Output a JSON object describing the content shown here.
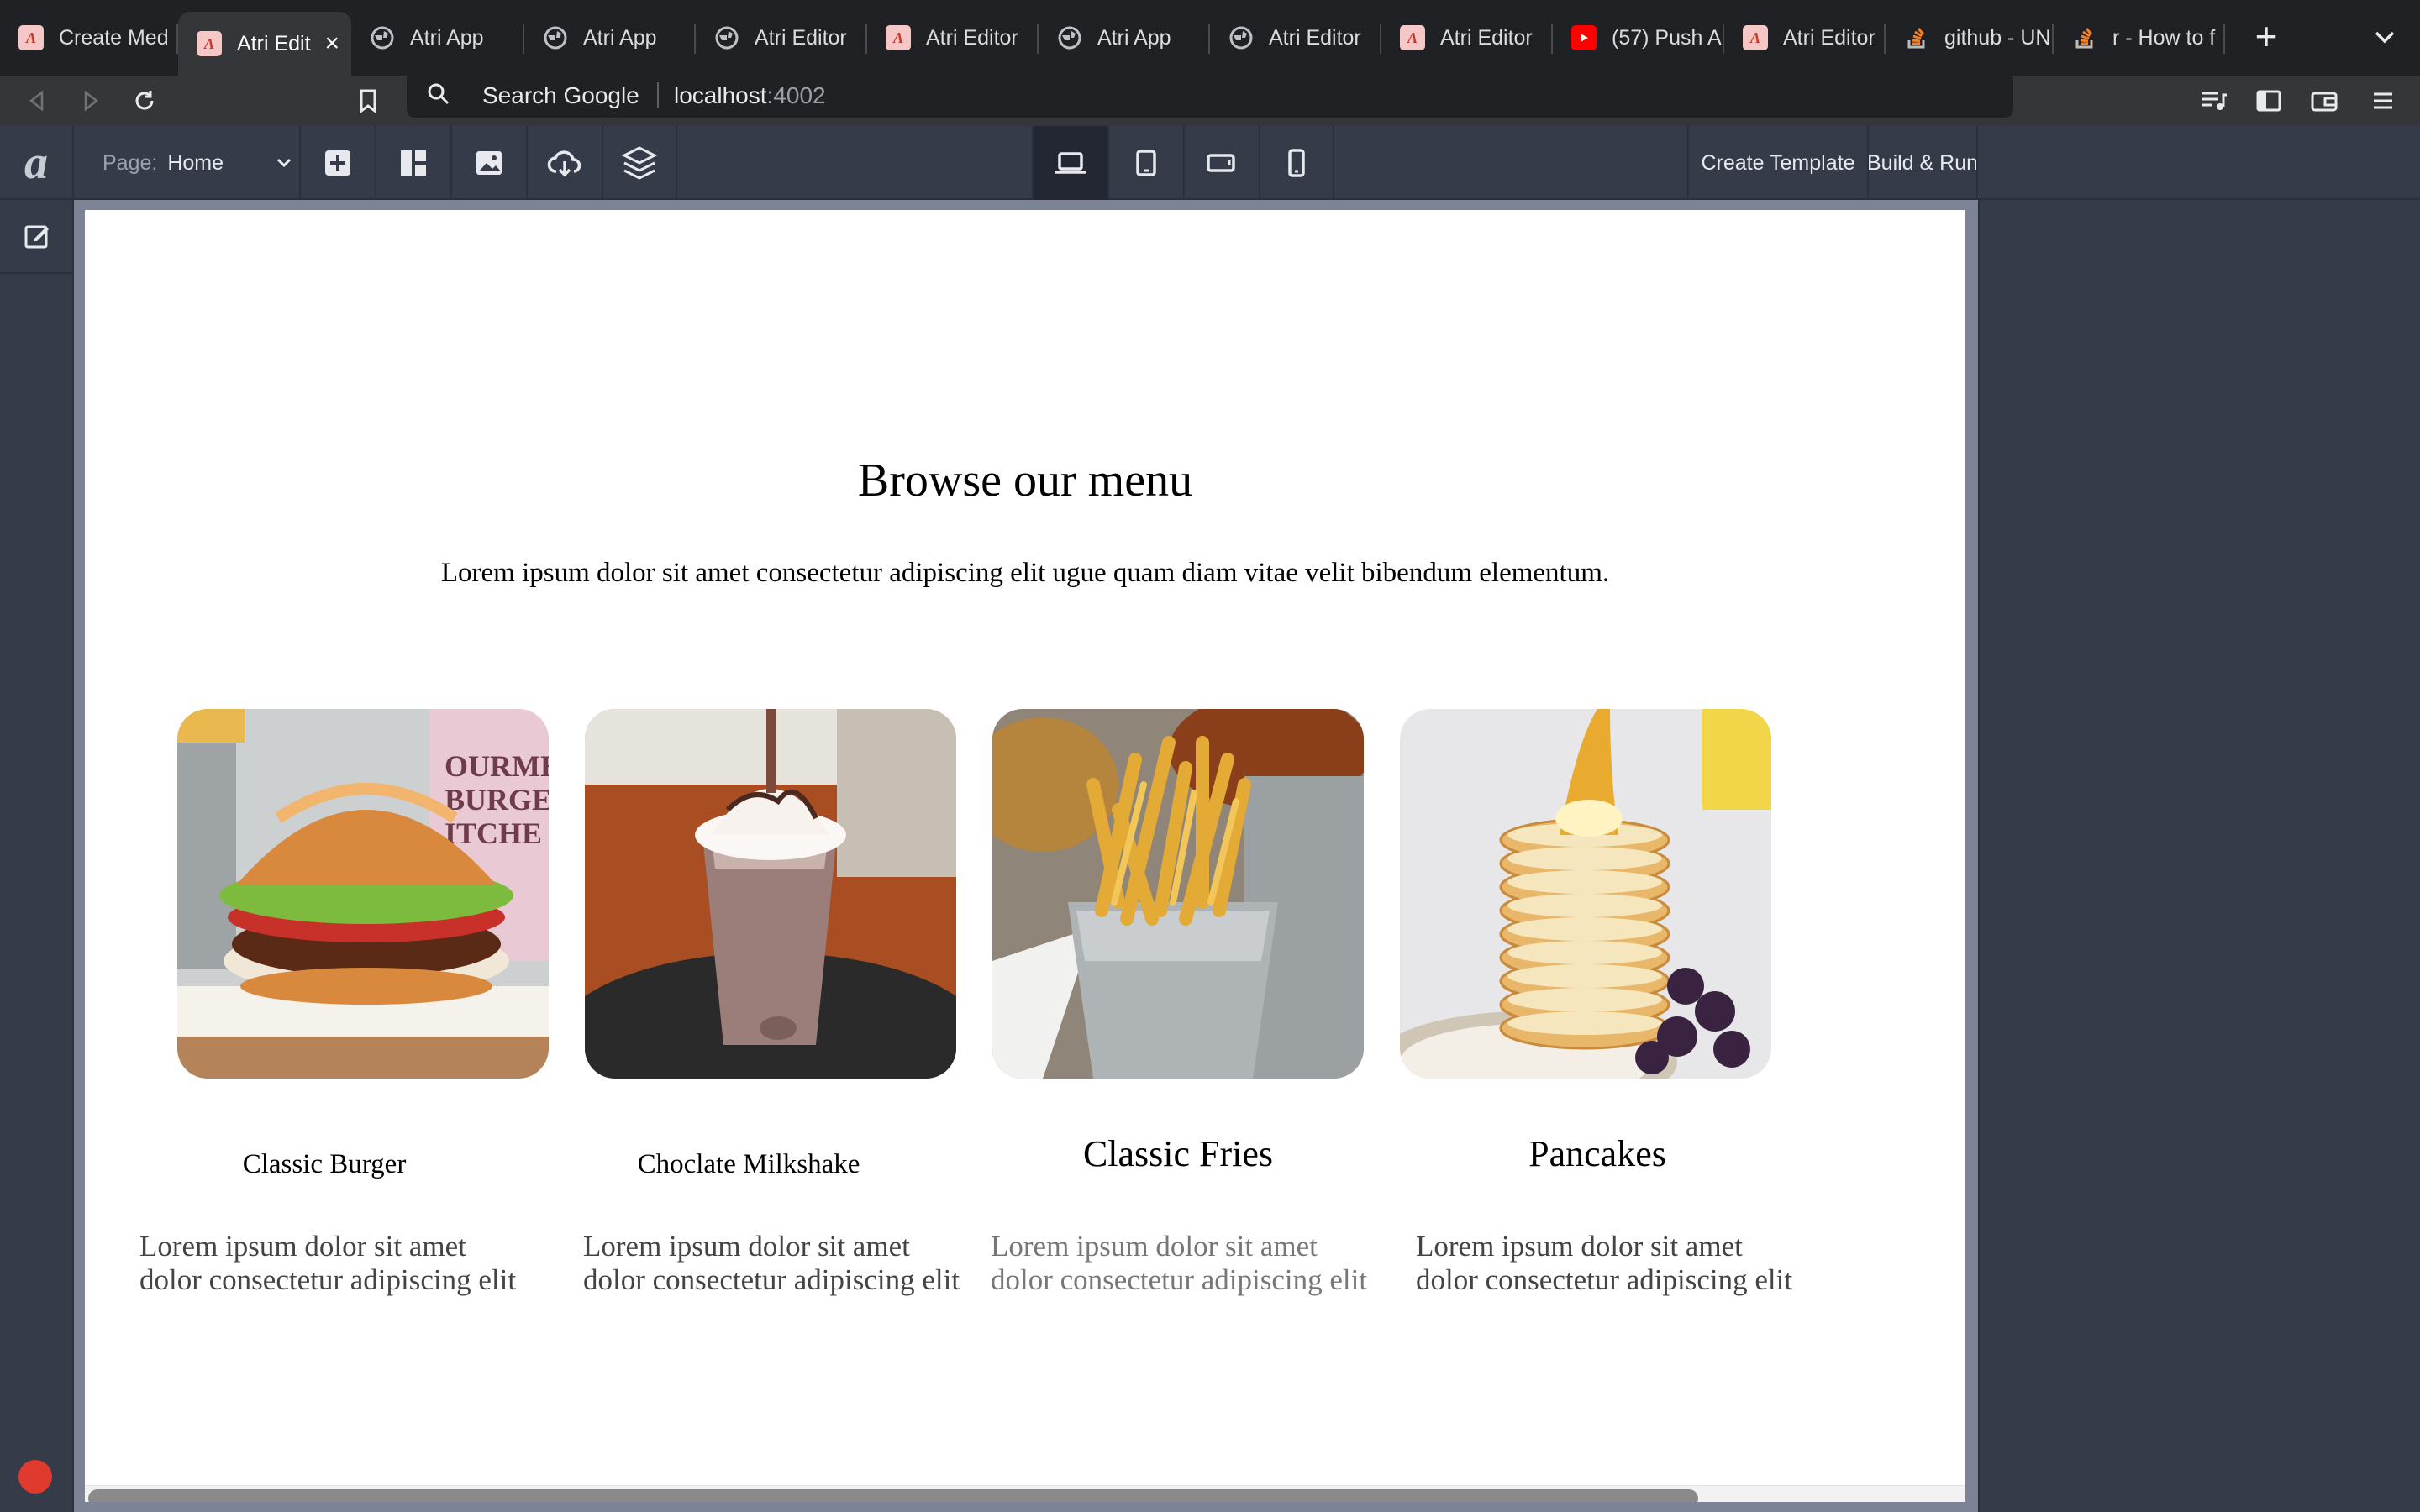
{
  "browser": {
    "tabs": [
      {
        "title": "Create Med",
        "favicon": "atri-icon"
      },
      {
        "title": "Atri Edit",
        "favicon": "atri-icon",
        "active": true
      },
      {
        "title": "Atri App",
        "favicon": "globe-icon"
      },
      {
        "title": "Atri App",
        "favicon": "globe-icon"
      },
      {
        "title": "Atri Editor",
        "favicon": "globe-icon"
      },
      {
        "title": "Atri Editor",
        "favicon": "atri-icon"
      },
      {
        "title": "Atri App",
        "favicon": "globe-icon"
      },
      {
        "title": "Atri Editor",
        "favicon": "globe-icon"
      },
      {
        "title": "Atri Editor",
        "favicon": "atri-icon"
      },
      {
        "title": "(57) Push A",
        "favicon": "youtube-icon"
      },
      {
        "title": "Atri Editor",
        "favicon": "atri-icon"
      },
      {
        "title": "github - UN",
        "favicon": "stackoverflow-icon"
      },
      {
        "title": "r - How to f",
        "favicon": "stackoverflow-icon"
      }
    ],
    "omnibox": {
      "hint": "Search Google",
      "host": "localhost",
      "port": ":4002"
    }
  },
  "editor": {
    "logo": "a",
    "page_select": {
      "label": "Page:",
      "value": "Home"
    },
    "create_template_label": "Create Template",
    "build_run_label": "Build & Run",
    "active_device": "desktop"
  },
  "canvas": {
    "title": "Browse our menu",
    "subtitle": "Lorem ipsum dolor sit amet consectetur adipiscing elit ugue quam diam vitae velit bibendum elementum.",
    "items": [
      {
        "name": "Classic Burger",
        "desc_line1": "Lorem ipsum dolor sit amet",
        "desc_line2": "dolor consectetur adipiscing elit"
      },
      {
        "name": "Choclate Milkshake",
        "desc_line1": "Lorem ipsum dolor sit amet",
        "desc_line2": "dolor consectetur adipiscing elit"
      },
      {
        "name": "Classic Fries",
        "desc_line1": "Lorem ipsum dolor sit amet",
        "desc_line2": "dolor consectetur adipiscing elit"
      },
      {
        "name": "Pancakes",
        "desc_line1": "Lorem ipsum dolor sit amet",
        "desc_line2": "dolor consectetur adipiscing elit"
      }
    ]
  },
  "colors": {
    "editor_bg": "#353b48",
    "canvas_frame": "#7c8394",
    "tabstrip_bg": "#202124",
    "record_dot": "#e03a2f"
  }
}
